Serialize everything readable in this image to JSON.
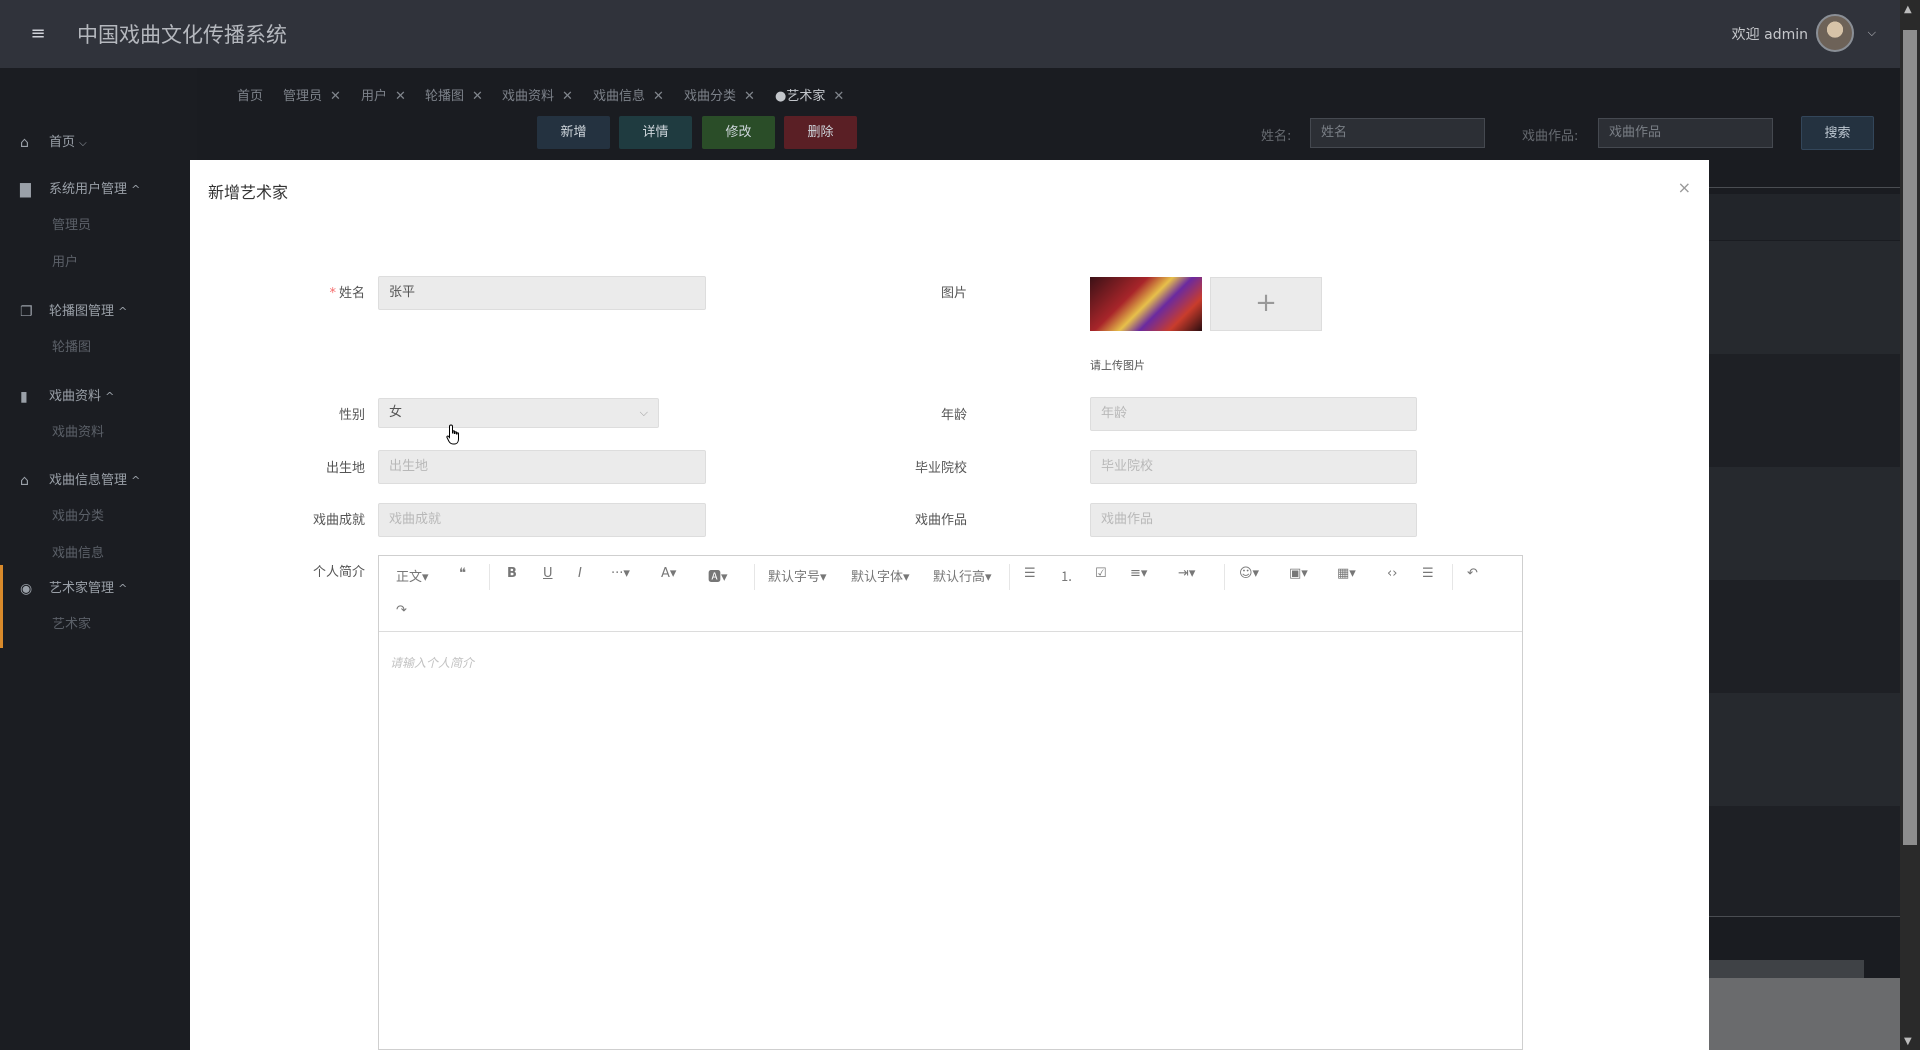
{
  "app": {
    "title": "中国戏曲文化传播系统",
    "welcome": "欢迎 admin",
    "hamburger_icon": "≡",
    "avatar_caret": "⌵"
  },
  "sidebar": {
    "groups": [
      {
        "label": "首页",
        "icon": "home-icon",
        "glyph": "⌂",
        "arrow": "⌵",
        "subs": []
      },
      {
        "label": "系统用户管理",
        "icon": "users-icon",
        "glyph": "▇",
        "arrow": "^",
        "subs": [
          "管理员",
          "用户"
        ]
      },
      {
        "label": "轮播图管理",
        "icon": "images-icon",
        "glyph": "❐",
        "arrow": "^",
        "subs": [
          "轮播图"
        ]
      },
      {
        "label": "戏曲资料",
        "icon": "book-icon",
        "glyph": "▮",
        "arrow": "^",
        "subs": [
          "戏曲资料"
        ]
      },
      {
        "label": "戏曲信息管理",
        "icon": "bank-icon",
        "glyph": "⌂",
        "arrow": "^",
        "subs": [
          "戏曲分类",
          "戏曲信息"
        ]
      },
      {
        "label": "艺术家管理",
        "icon": "compass-icon",
        "glyph": "◉",
        "arrow": "^",
        "subs": [
          "艺术家"
        ]
      }
    ]
  },
  "tabs": [
    {
      "label": "首页",
      "closable": false
    },
    {
      "label": "管理员",
      "closable": true
    },
    {
      "label": "用户",
      "closable": true
    },
    {
      "label": "轮播图",
      "closable": true
    },
    {
      "label": "戏曲资料",
      "closable": true
    },
    {
      "label": "戏曲信息",
      "closable": true
    },
    {
      "label": "戏曲分类",
      "closable": true
    },
    {
      "label": "●艺术家",
      "closable": true
    }
  ],
  "tab_close_glyph": "✕",
  "toolbar": {
    "add": "新增",
    "detail": "详情",
    "edit": "修改",
    "delete": "删除",
    "colors": {
      "add": "#243240",
      "detail": "#1f3b40",
      "edit": "#2a4d28",
      "delete": "#5a1f25"
    }
  },
  "search": {
    "name_label": "姓名:",
    "name_placeholder": "姓名",
    "work_label": "戏曲作品:",
    "work_placeholder": "戏曲作品",
    "button": "搜索"
  },
  "modal": {
    "title": "新增艺术家",
    "close_glyph": "×",
    "fields": {
      "name_label": "姓名",
      "name_value": "张平",
      "image_label": "图片",
      "image_hint": "请上传图片",
      "image_add_glyph": "+",
      "gender_label": "性别",
      "gender_value": "女",
      "age_label": "年龄",
      "age_placeholder": "年龄",
      "birthplace_label": "出生地",
      "birthplace_placeholder": "出生地",
      "school_label": "毕业院校",
      "school_placeholder": "毕业院校",
      "achievement_label": "戏曲成就",
      "achievement_placeholder": "戏曲成就",
      "works_label": "戏曲作品",
      "works_placeholder": "戏曲作品",
      "intro_label": "个人简介"
    },
    "editor": {
      "placeholder": "请输入个人简介",
      "toolbar": {
        "paragraph": "正文▾",
        "quote": "❝",
        "bold": "B",
        "underline": "U",
        "italic": "I",
        "more": "···▾",
        "font_color": "A▾",
        "bg_color": "🅰▾",
        "font_size": "默认字号▾",
        "font_family": "默认字体▾",
        "line_height": "默认行高▾",
        "bullet_list": "☰",
        "number_list": "⒈",
        "todo": "☑",
        "align": "≡▾",
        "indent": "⇥▾",
        "emoji": "☺▾",
        "image": "▣▾",
        "table": "▦▾",
        "code": "‹›",
        "divider": "☰",
        "undo": "↶",
        "redo": "↷"
      }
    }
  },
  "accent_color": "#d98a2b"
}
